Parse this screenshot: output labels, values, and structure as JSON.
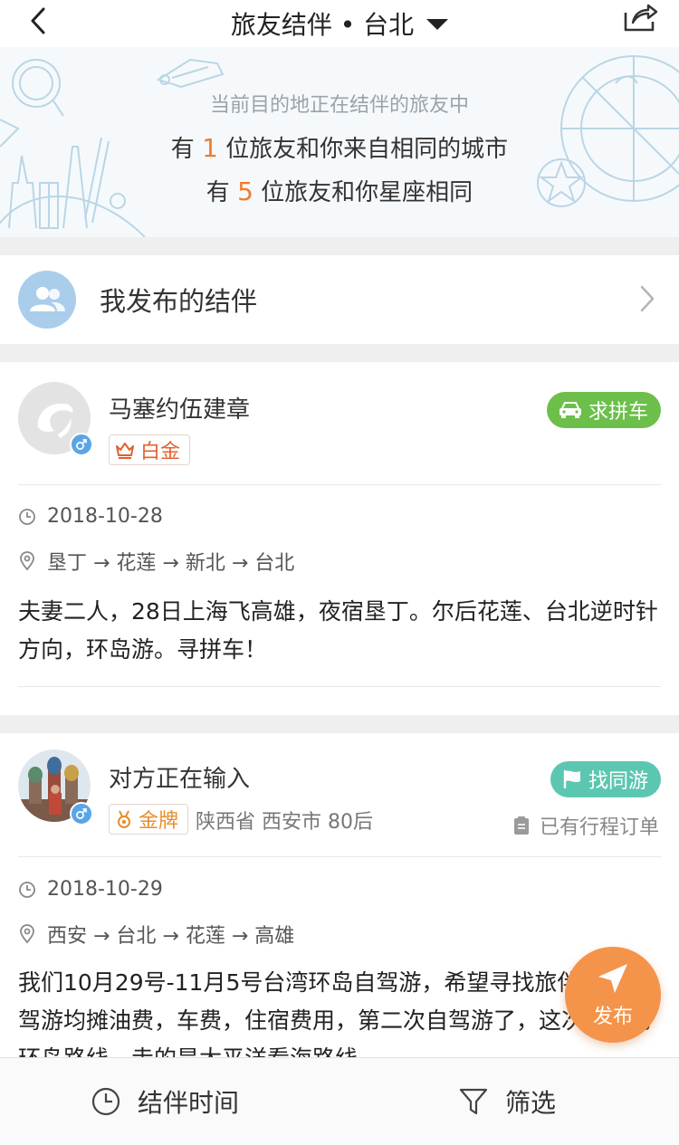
{
  "header": {
    "title": "旅友结伴 • 台北",
    "back_icon": "chevron-left-icon",
    "share_icon": "share-icon"
  },
  "banner": {
    "line1": "当前目的地正在结伴的旅友中",
    "line2_pre": "有",
    "line2_num": "1",
    "line2_post": "位旅友和你来自相同的城市",
    "line3_pre": "有",
    "line3_num": "5",
    "line3_post": "位旅友和你星座相同"
  },
  "my_posts": {
    "label": "我发布的结伴",
    "icon": "users-icon"
  },
  "posts": [
    {
      "name": "马塞约伍建章",
      "badge": "白金",
      "badge_color": "#e0612e",
      "tag": "求拼车",
      "tag_color": "#6cbf4a",
      "date": "2018-10-28",
      "route": "垦丁 → 花莲 → 新北 → 台北",
      "description": "夫妻二人，28日上海飞高雄，夜宿垦丁。尔后花莲、台北逆时针方向，环岛游。寻拼车！"
    },
    {
      "name": "对方正在输入",
      "badge": "金牌",
      "badge_color": "#e98d2a",
      "extra": "陕西省 西安市 80后",
      "tag": "找同游",
      "tag_color": "#5cc7b0",
      "order_status": "已有行程订单",
      "date": "2018-10-29",
      "route": "西安 → 台北 → 花莲 → 高雄",
      "description": "我们10月29号-11月5号台湾环岛自驾游，希望寻找旅伴一起自驾游均摊油费，车费，住宿费用，第二次自驾游了，这次南边的环岛路线，走的是太平洋看海路线"
    }
  ],
  "fab": {
    "label": "发布"
  },
  "bottom_bar": {
    "time_label": "结伴时间",
    "filter_label": "筛选"
  },
  "colors": {
    "accent_orange": "#f07b2f",
    "fab_orange": "#f4944a",
    "gender_blue": "#5aa5e6"
  }
}
